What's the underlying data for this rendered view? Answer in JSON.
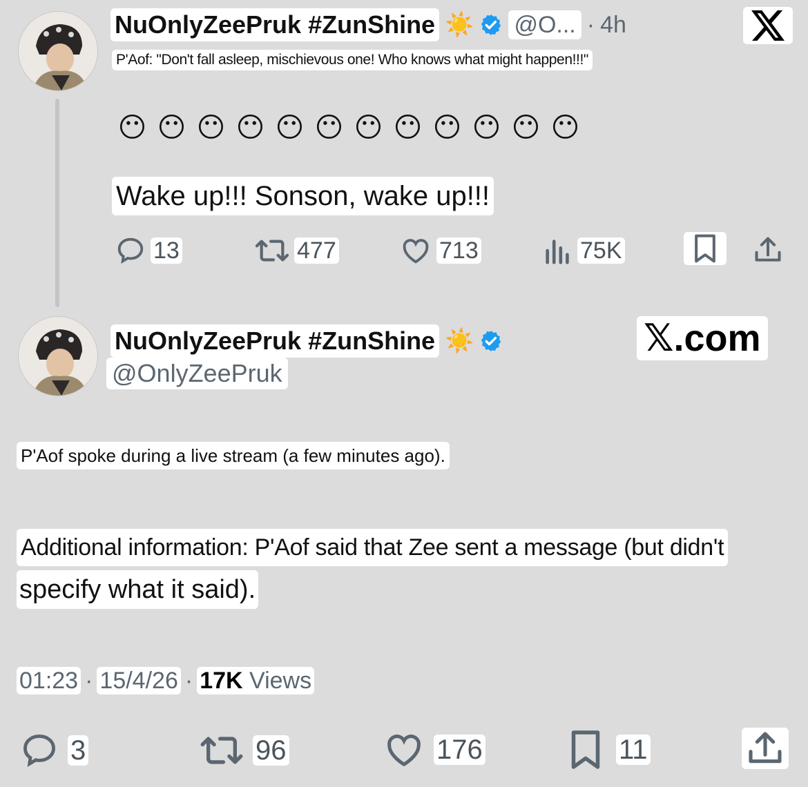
{
  "tweet1": {
    "display_name": "NuOnlyZeePruk #ZunShine",
    "name_emoji": "☀️",
    "handle": "@O...",
    "separator": "·",
    "time": "4h",
    "quote": "P'Aof: \"Don't fall asleep, mischievous one! Who knows what might happen!!!\"",
    "emojis": [
      "😶",
      "😶",
      "😶",
      "😶",
      "😶",
      "😶",
      "😶",
      "😶",
      "😶",
      "😶",
      "😶",
      "😶"
    ],
    "text": "Wake up!!! Sonson, wake up!!!",
    "metrics": {
      "replies": "13",
      "reposts": "477",
      "likes": "713",
      "views": "75K"
    }
  },
  "tweet2": {
    "display_name": "NuOnlyZeePruk #ZunShine",
    "name_emoji": "☀️",
    "handle": "@OnlyZeePruk",
    "line1": "P'Aof spoke during a live stream (a few minutes ago).",
    "line2a": "Additional information: P'Aof said that Zee sent a message (but didn't",
    "line2b": "specify what it said).",
    "time": "01:23",
    "dot1": "·",
    "date": "15/4/26",
    "dot2": "·",
    "views_count": "17K",
    "views_label": "Views",
    "metrics": {
      "replies": "3",
      "reposts": "96",
      "likes": "176",
      "bookmarks": "11"
    }
  },
  "brand": {
    "logo_text": "𝕏",
    "site_label": "𝕏.com"
  },
  "colors": {
    "background": "#dcdcdc",
    "verified": "#1d9bf0",
    "icon_gray": "#5b6670"
  },
  "icons": [
    "x-logo-icon",
    "verified-badge-icon",
    "reply-icon",
    "repost-icon",
    "like-icon",
    "views-icon",
    "bookmark-icon",
    "share-icon"
  ]
}
